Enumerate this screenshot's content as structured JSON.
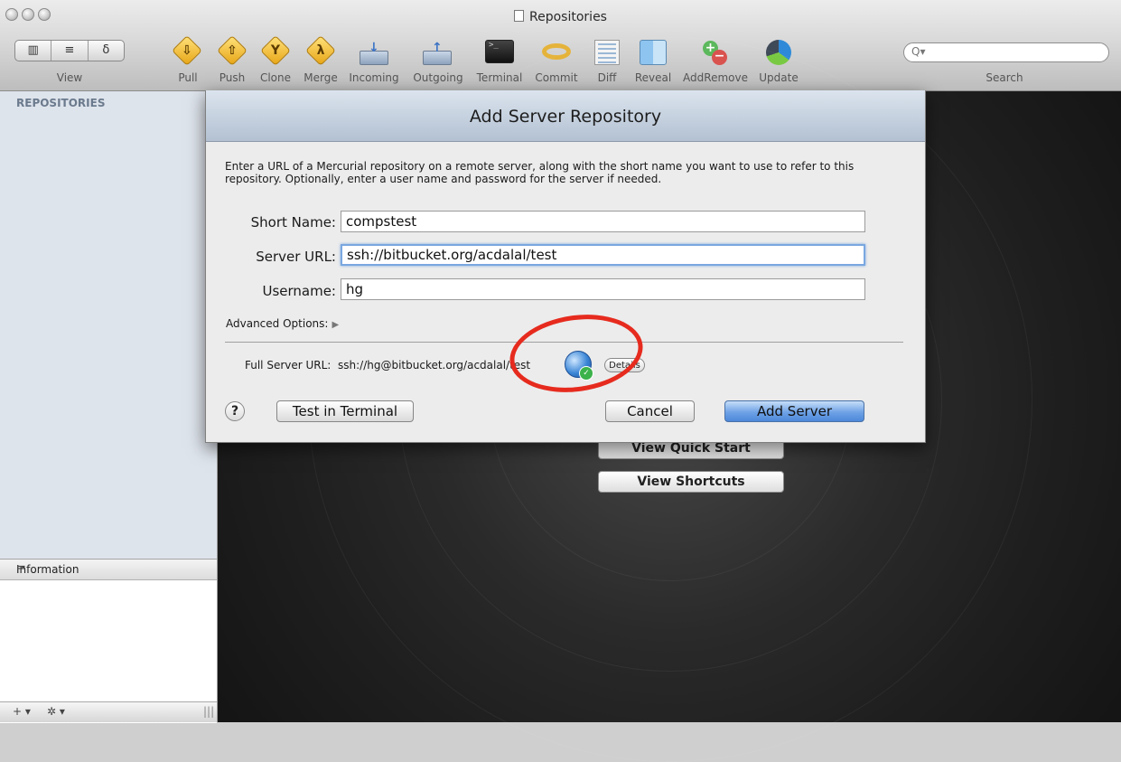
{
  "window": {
    "title": "Repositories"
  },
  "toolbar": {
    "view_label": "View",
    "view_segments": [
      "▥",
      "≡",
      "δ"
    ],
    "items": [
      {
        "label": "Pull",
        "glyph": "⇩"
      },
      {
        "label": "Push",
        "glyph": "⇧"
      },
      {
        "label": "Clone",
        "glyph": "Y"
      },
      {
        "label": "Merge",
        "glyph": "λ"
      },
      {
        "label": "Incoming"
      },
      {
        "label": "Outgoing"
      },
      {
        "label": "Terminal"
      },
      {
        "label": "Commit"
      },
      {
        "label": "Diff"
      },
      {
        "label": "Reveal"
      },
      {
        "label": "AddRemove"
      },
      {
        "label": "Update"
      }
    ],
    "search_label": "Search",
    "search_placeholder": ""
  },
  "sidebar": {
    "header": "REPOSITORIES",
    "info_title": "Information",
    "info_grip": "=",
    "bottom_add": "+ ▾",
    "bottom_gear": "✲ ▾",
    "bottom_grip": "|||"
  },
  "main": {
    "buttons": [
      "View Quick Start",
      "View Shortcuts"
    ]
  },
  "sheet": {
    "title": "Add Server Repository",
    "description": "Enter a URL of a Mercurial repository on a remote server, along with the short name you want to use to refer to this repository. Optionally, enter a user name and password for the server if needed.",
    "short_name_label": "Short Name:",
    "short_name_value": "compstest",
    "server_url_label": "Server URL:",
    "server_url_value": "ssh://bitbucket.org/acdalal/test",
    "username_label": "Username:",
    "username_value": "hg",
    "advanced_label": "Advanced Options:",
    "full_url_label": "Full Server URL:",
    "full_url_value": "ssh://hg@bitbucket.org/acdalal/test",
    "details_label": "Details",
    "help_label": "?",
    "test_terminal_label": "Test in Terminal",
    "cancel_label": "Cancel",
    "add_server_label": "Add Server"
  },
  "colors": {
    "annotation": "#e62b1e",
    "primary_button": "#6ea2e6",
    "sidebar_bg": "#dee4ec"
  }
}
